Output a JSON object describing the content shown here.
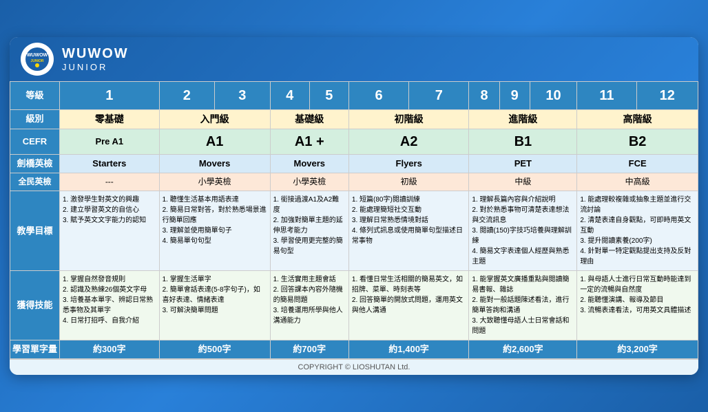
{
  "header": {
    "logo_text": "WUWOW",
    "logo_sub": "JUNIOR"
  },
  "footer": {
    "text": "COPYRIGHT © LIOSHUTAN Ltd."
  },
  "table": {
    "rows": {
      "dengji": {
        "label": "等級",
        "levels": [
          "1",
          "2",
          "3",
          "4",
          "5",
          "6",
          "7",
          "8",
          "9",
          "10",
          "11",
          "12"
        ]
      },
      "jibei": {
        "label": "級別",
        "groups": [
          {
            "text": "零基礎",
            "span": 1
          },
          {
            "text": "入門級",
            "span": 2
          },
          {
            "text": "基礎級",
            "span": 2
          },
          {
            "text": "初階級",
            "span": 2
          },
          {
            "text": "進階級",
            "span": 3
          },
          {
            "text": "高階級",
            "span": 2
          }
        ]
      },
      "cefr": {
        "label": "CEFR",
        "groups": [
          {
            "text": "Pre A1",
            "span": 1
          },
          {
            "text": "A1",
            "span": 2
          },
          {
            "text": "A1 +",
            "span": 2
          },
          {
            "text": "A2",
            "span": 2
          },
          {
            "text": "B1",
            "span": 3
          },
          {
            "text": "B2",
            "span": 2
          }
        ]
      },
      "cambridge": {
        "label": "劍橋英檢",
        "groups": [
          {
            "text": "Starters",
            "span": 1
          },
          {
            "text": "Movers",
            "span": 2
          },
          {
            "text": "Movers",
            "span": 2
          },
          {
            "text": "Flyers",
            "span": 2
          },
          {
            "text": "PET",
            "span": 3
          },
          {
            "text": "FCE",
            "span": 2
          }
        ]
      },
      "gept": {
        "label": "全民英檢",
        "groups": [
          {
            "text": "---",
            "span": 1
          },
          {
            "text": "小學英檢",
            "span": 2
          },
          {
            "text": "小學英檢",
            "span": 2
          },
          {
            "text": "初級",
            "span": 2
          },
          {
            "text": "中級",
            "span": 3
          },
          {
            "text": "中高級",
            "span": 2
          }
        ]
      },
      "teaching": {
        "label": "教學目標",
        "cells": [
          {
            "content": "1. 激發學生對英文的興趣\n2. 建立學習英文的自信心\n3. 賦予英文文字能力的認知",
            "span": 1
          },
          {
            "content": "1. 聽懂生活基本用語表達\n2. 簡易日常對答，對於熟悉場景進行簡單回應\n3. 理解並使用簡單句子\n4. 簡易單句句型",
            "span": 2
          },
          {
            "content": "1. 銜接過渡A1及A2難度\n2. 加強對簡單主題的延伸思考能力\n3. 學習使用更完整的簡易句型",
            "span": 2
          },
          {
            "content": "1. 短篇(80字)閱讀訓練\n2. 能處理簡短社交互動\n3. 理解日常熟悉情境對話\n4. 條列式訊息或使用簡單句型描述日常事物",
            "span": 2
          },
          {
            "content": "1. 理解長篇內容與介紹說明\n2. 對於熟悉事物可清楚表達想法與交流訊息\n3. 閱讀(150)字技巧培養與理解訓練\n4. 簡易文字表達個人經歷與熟悉主題",
            "span": 3
          },
          {
            "content": "1. 能處理較複雜或抽象主題並進行交流討論\n2. 清楚表達自身觀點，可即時用英文互動\n3. 提升閱讀素養(200字)\n4. 針對單一特定觀點提出支持及反對理由",
            "span": 2
          }
        ]
      },
      "skills": {
        "label": "獲得技能",
        "cells": [
          {
            "content": "1. 掌握自然發音規則\n2. 認識及熟練26個英文字母\n3. 培養基本單字、辨認日常熟悉事物及其單字\n4. 日常打招呼、自我介紹",
            "span": 1
          },
          {
            "content": "1. 掌握生活單字\n2. 簡單會話表達(5-8字句子)，如喜好表達、情緒表達\n3. 可解決簡單問題",
            "span": 2
          },
          {
            "content": "1. 生活實用主題會話\n2. 回答課本內容外隨機的簡易問題\n3. 培養運用所學與他人溝通能力",
            "span": 2
          },
          {
            "content": "1. 看懂日常生活相關的簡易英文，如招牌、菜單、時刻表等\n2. 回答簡單的開放式問題，運用英文與他人溝通",
            "span": 2
          },
          {
            "content": "1. 能掌握英文廣播重點與閱讀簡易書報、雜誌\n2. 能對一般話題陳述看法，進行簡單答詢和溝通\n3. 大致聽懂母語人士日常會話和問題",
            "span": 3
          },
          {
            "content": "1. 與母語人士進行日常互動時能達到一定的流暢與自然度\n2. 能聽懂演講、報導及節目\n3. 流暢表達看法，可用英文具體描述",
            "span": 2
          }
        ]
      },
      "vocab": {
        "label": "學習單字量",
        "groups": [
          {
            "text": "約300字",
            "span": 1
          },
          {
            "text": "約500字",
            "span": 2
          },
          {
            "text": "約700字",
            "span": 2
          },
          {
            "text": "約1,400字",
            "span": 2
          },
          {
            "text": "約2,600字",
            "span": 3
          },
          {
            "text": "約3,200字",
            "span": 2
          }
        ]
      }
    }
  }
}
